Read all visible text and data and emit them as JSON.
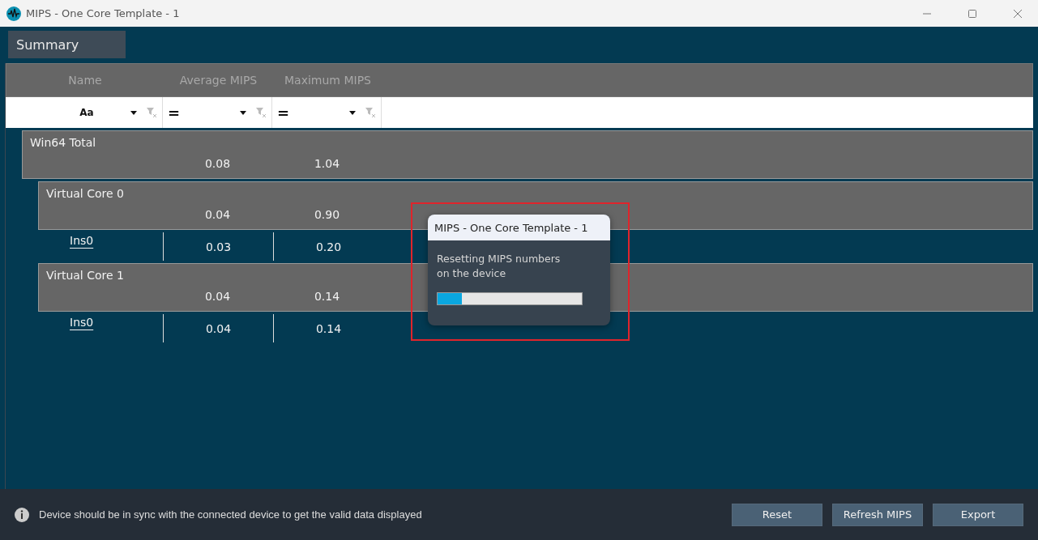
{
  "window": {
    "title": "MIPS - One Core Template - 1"
  },
  "tabs": [
    {
      "label": "Summary",
      "selected": true
    }
  ],
  "table": {
    "columns": [
      "Name",
      "Average MIPS",
      "Maximum MIPS"
    ],
    "filters": [
      {
        "operator": "Aa"
      },
      {
        "operator": "="
      },
      {
        "operator": "="
      }
    ],
    "rows": [
      {
        "kind": "group",
        "name": "Win64 Total",
        "average": "0.08",
        "maximum": "1.04",
        "children": [
          {
            "kind": "group",
            "name": "Virtual Core 0",
            "average": "0.04",
            "maximum": "0.90",
            "children": [
              {
                "kind": "leaf",
                "name": "Ins0",
                "average": "0.03",
                "maximum": "0.20"
              }
            ]
          },
          {
            "kind": "group",
            "name": "Virtual Core 1",
            "average": "0.04",
            "maximum": "0.14",
            "children": [
              {
                "kind": "leaf",
                "name": "Ins0",
                "average": "0.04",
                "maximum": "0.14"
              }
            ]
          }
        ]
      }
    ]
  },
  "dialog": {
    "title": "MIPS - One Core Template - 1",
    "message": "Resetting MIPS numbers on the device",
    "progress": {
      "level": 0.17
    }
  },
  "status_bar": {
    "message": "Device should be in sync with the connected device to get the valid data displayed",
    "buttons": [
      "Reset",
      "Refresh MIPS",
      "Export"
    ]
  }
}
